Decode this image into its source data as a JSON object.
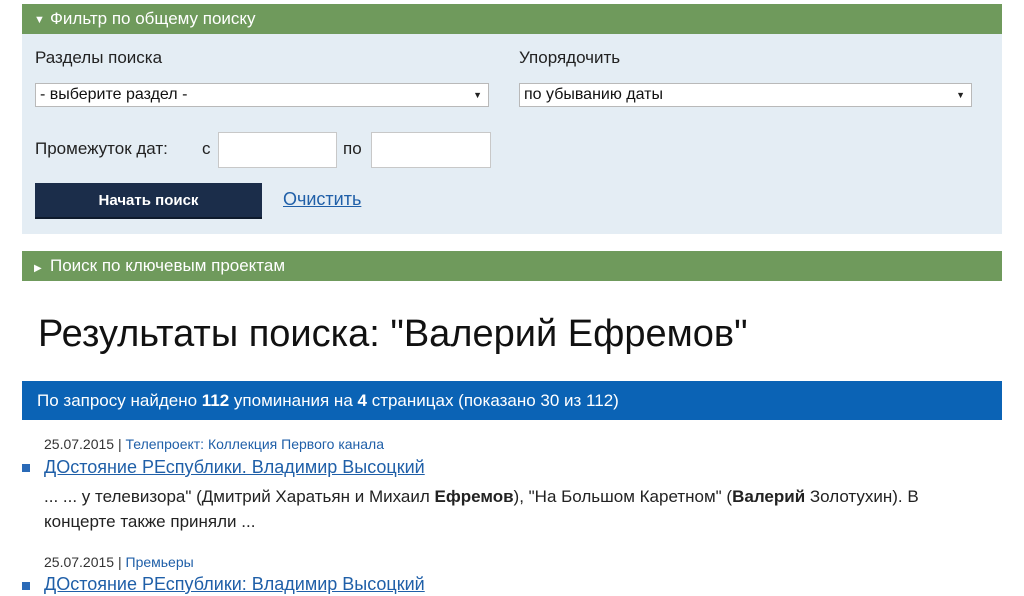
{
  "filter": {
    "header": "Фильтр по общему поиску",
    "sections_label": "Разделы поиска",
    "sections_value": "- выберите раздел -",
    "order_label": "Упорядочить",
    "order_value": "по убыванию даты",
    "date_range_label": "Промежуток дат:",
    "date_from_label": "с",
    "date_to_label": "по",
    "date_from_value": "",
    "date_to_value": "",
    "search_button": "Начать поиск",
    "clear_link": "Очистить"
  },
  "projects": {
    "header": "Поиск по ключевым проектам"
  },
  "results": {
    "title": "Результаты поиска: \"Валерий Ефремов\"",
    "summary": {
      "prefix": "По запросу найдено ",
      "count": "112",
      "mid": " упоминания на ",
      "pages": "4",
      "suffix": " страницах (показано 30 из 112)"
    },
    "items": [
      {
        "date": "25.07.2015",
        "separator": "|",
        "category": "Телепроект: Коллекция Первого канала",
        "title": "ДОстояние РЕспублики. Владимир Высоцкий",
        "snippet_a": "... ... у телевизора\" (Дмитрий Харатьян и Михаил ",
        "snippet_b": "Ефремов",
        "snippet_c": "), \"На Большом Каретном\" (",
        "snippet_d": "Валерий",
        "snippet_e": " Золотухин). В концерте также приняли ..."
      },
      {
        "date": "25.07.2015",
        "separator": "|",
        "category": "Премьеры",
        "title": "ДОстояние РЕспублики: Владимир Высоцкий"
      }
    ]
  },
  "colors": {
    "green_bar": "#6f9a5c",
    "panel_bg": "#e4edf4",
    "button_bg": "#1b2d4a",
    "info_bar": "#0b63b5",
    "link": "#1f5fa8"
  }
}
